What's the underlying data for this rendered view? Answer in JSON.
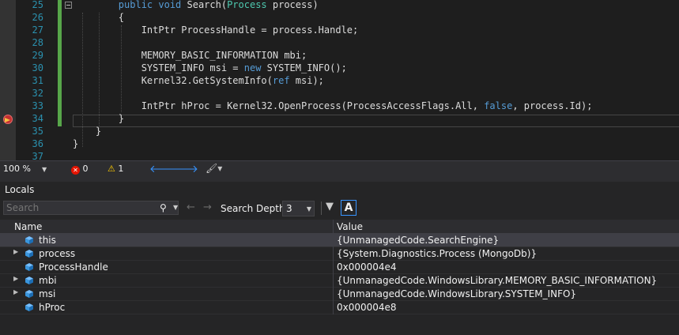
{
  "editor": {
    "lines": [
      {
        "num": "25",
        "code": [
          [
            "kw",
            "public "
          ],
          [
            "kw",
            "void "
          ],
          [
            "",
            "Search("
          ],
          [
            "ty",
            "Process "
          ],
          [
            "",
            "process)"
          ]
        ],
        "indent": "        "
      },
      {
        "num": "26",
        "code": [
          [
            "",
            "{"
          ]
        ],
        "indent": "        "
      },
      {
        "num": "27",
        "code": [
          [
            "",
            "IntPtr "
          ],
          [
            "",
            "ProcessHandle"
          ],
          [
            "",
            " = process.Handle;"
          ]
        ],
        "indent": "            "
      },
      {
        "num": "28",
        "code": [],
        "indent": ""
      },
      {
        "num": "29",
        "code": [
          [
            "",
            "MEMORY_BASIC_INFORMATION "
          ],
          [
            "",
            "mbi"
          ],
          [
            "",
            ";"
          ]
        ],
        "indent": "            "
      },
      {
        "num": "30",
        "code": [
          [
            "",
            "SYSTEM_INFO msi = "
          ],
          [
            "kw",
            "new "
          ],
          [
            "",
            "SYSTEM_INFO();"
          ]
        ],
        "indent": "            "
      },
      {
        "num": "31",
        "code": [
          [
            "",
            "Kernel32.GetSystemInfo("
          ],
          [
            "kw",
            "ref "
          ],
          [
            "",
            "msi);"
          ]
        ],
        "indent": "            "
      },
      {
        "num": "32",
        "code": [],
        "indent": ""
      },
      {
        "num": "33",
        "code": [
          [
            "",
            "IntPtr "
          ],
          [
            "",
            "hProc"
          ],
          [
            "",
            " = Kernel32.OpenProcess(ProcessAccessFlags.All, "
          ],
          [
            "kw",
            "false"
          ],
          [
            "",
            ", process.Id);"
          ]
        ],
        "indent": "            "
      },
      {
        "num": "34",
        "code": [
          [
            "",
            "}"
          ]
        ],
        "indent": "        "
      },
      {
        "num": "35",
        "code": [
          [
            "",
            "}"
          ]
        ],
        "indent": "    "
      },
      {
        "num": "36",
        "code": [
          [
            "",
            "}"
          ]
        ],
        "indent": ""
      },
      {
        "num": "37",
        "code": [],
        "indent": ""
      }
    ]
  },
  "status": {
    "zoom": "100 %",
    "errors": "0",
    "warnings": "1"
  },
  "locals": {
    "title": "Locals",
    "search_placeholder": "Search",
    "depth_label": "Search Depth:",
    "depth_value": "3",
    "columns": {
      "name": "Name",
      "value": "Value"
    },
    "rows": [
      {
        "name": "this",
        "value": "{UnmanagedCode.SearchEngine}",
        "expandable": false,
        "selected": true
      },
      {
        "name": "process",
        "value": "{System.Diagnostics.Process (MongoDb)}",
        "expandable": true,
        "selected": false
      },
      {
        "name": "ProcessHandle",
        "value": "0x000004e4",
        "expandable": false,
        "selected": false
      },
      {
        "name": "mbi",
        "value": "{UnmanagedCode.WindowsLibrary.MEMORY_BASIC_INFORMATION}",
        "expandable": true,
        "selected": false
      },
      {
        "name": "msi",
        "value": "{UnmanagedCode.WindowsLibrary.SYSTEM_INFO}",
        "expandable": true,
        "selected": false
      },
      {
        "name": "hProc",
        "value": "0x000004e8",
        "expandable": false,
        "selected": false
      }
    ]
  },
  "colors": {
    "keyword": "#569cd6",
    "type": "#4ec9b0",
    "line_number": "#2b91af",
    "change_bar": "#57a64a",
    "breakpoint": "#c53030"
  },
  "icons": {
    "breakpoint": "breakpoint-arrow-icon",
    "error": "error-icon",
    "warning": "warning-icon",
    "nav_back": "arrow-left-icon",
    "nav_forward": "arrow-right-icon",
    "search": "search-icon",
    "filter": "filter-icon",
    "font": "font-icon",
    "cube": "field-cube-icon"
  }
}
